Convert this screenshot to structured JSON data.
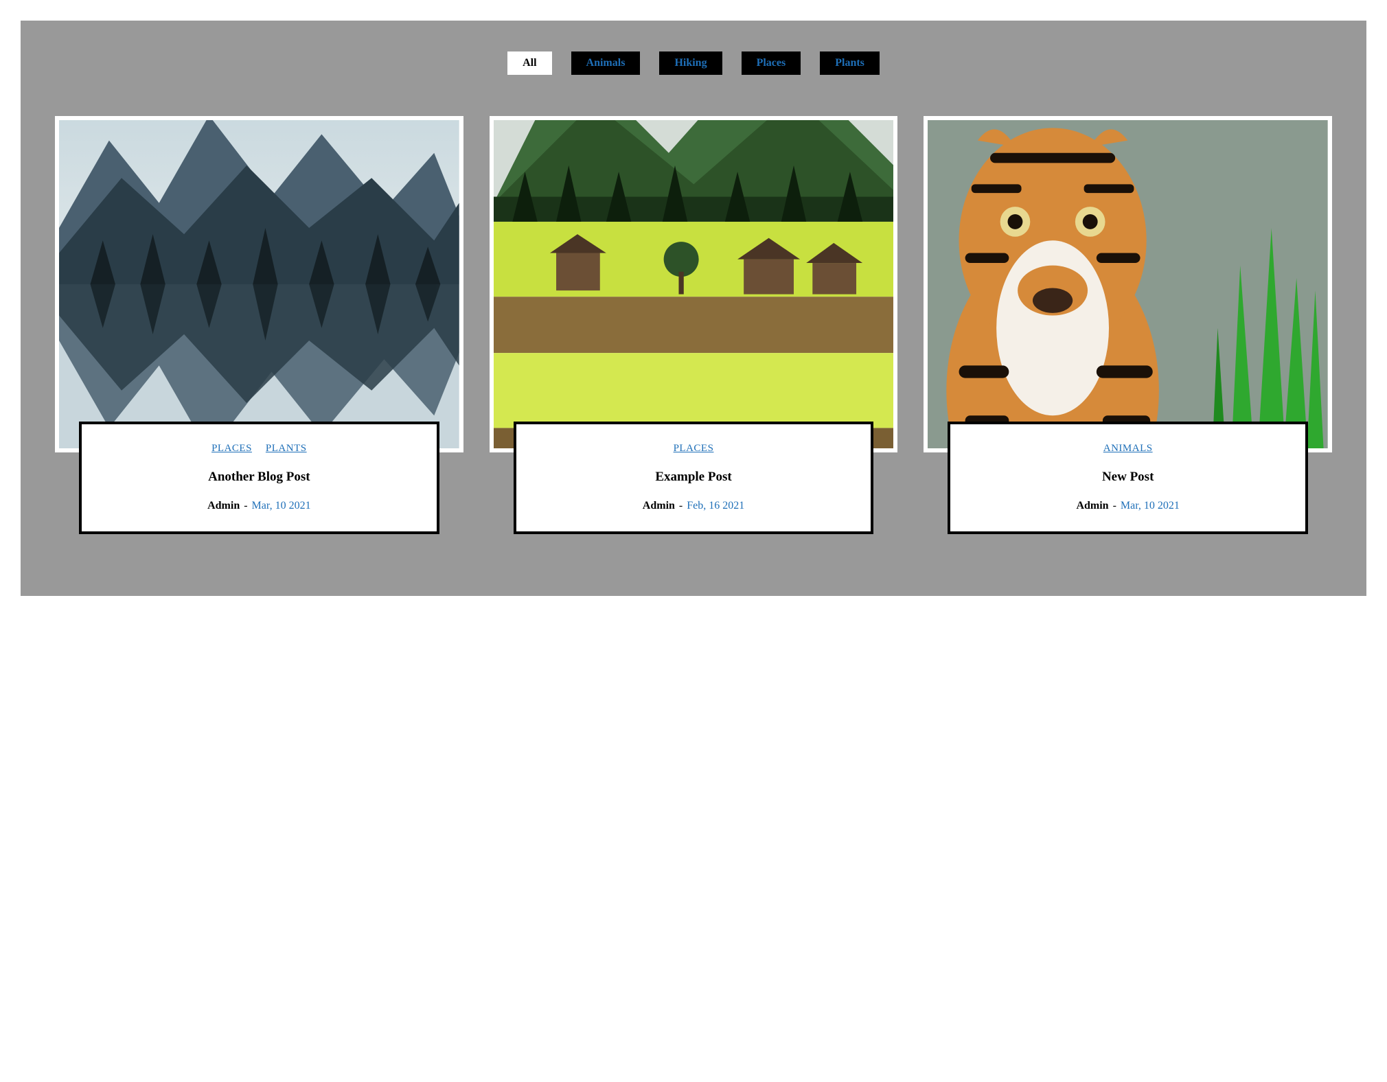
{
  "filters": [
    {
      "label": "All",
      "active": true
    },
    {
      "label": "Animals",
      "active": false
    },
    {
      "label": "Hiking",
      "active": false
    },
    {
      "label": "Places",
      "active": false
    },
    {
      "label": "Plants",
      "active": false
    }
  ],
  "cards": [
    {
      "tags": [
        "PLACES",
        "PLANTS"
      ],
      "title": "Another Blog Post",
      "author": "Admin",
      "sep": "-",
      "date": "Mar, 10 2021",
      "img": "mountains"
    },
    {
      "tags": [
        "PLACES"
      ],
      "title": "Example Post",
      "author": "Admin",
      "sep": "-",
      "date": "Feb, 16 2021",
      "img": "fields"
    },
    {
      "tags": [
        "ANIMALS"
      ],
      "title": "New Post",
      "author": "Admin",
      "sep": "-",
      "date": "Mar, 10 2021",
      "img": "tiger"
    }
  ]
}
